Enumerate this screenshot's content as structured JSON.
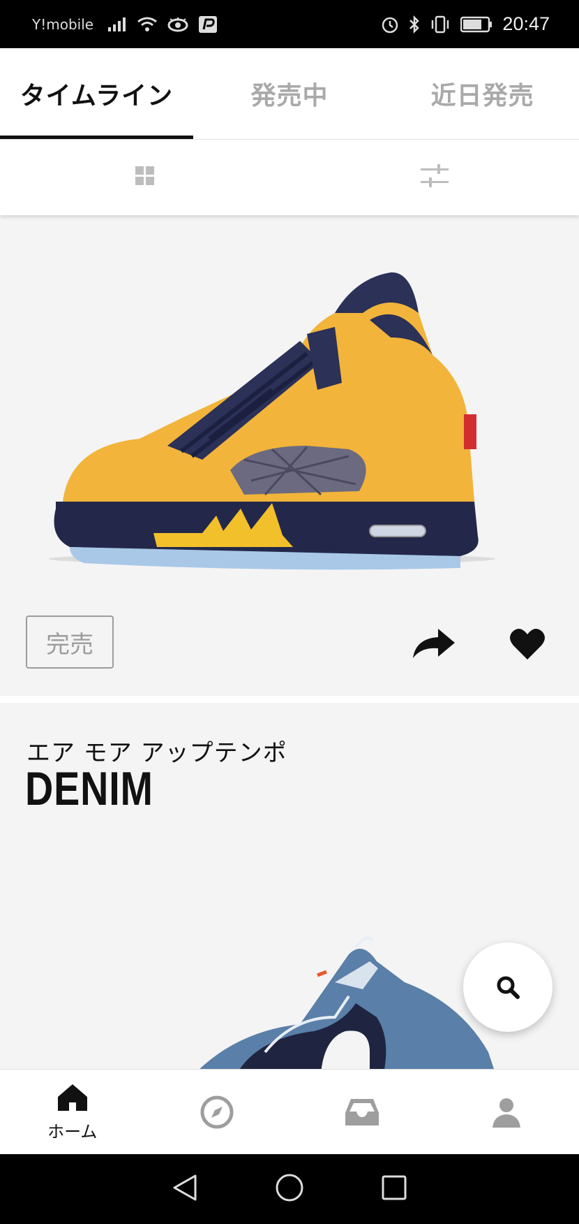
{
  "status_bar": {
    "carrier": "Y!mobile",
    "time": "20:47",
    "icons": [
      "signal-icon",
      "wifi-icon",
      "eye-icon",
      "paypay-icon",
      "alarm-icon",
      "bluetooth-icon",
      "vibrate-icon",
      "battery-icon"
    ]
  },
  "tabs": [
    {
      "label": "タイムライン",
      "active": true
    },
    {
      "label": "発売中",
      "active": false
    },
    {
      "label": "近日発売",
      "active": false
    }
  ],
  "toolbar": {
    "icons": [
      "grid-view-icon",
      "filter-sliders-icon"
    ]
  },
  "feed": {
    "card1": {
      "status_label": "完売",
      "actions": [
        "share-icon",
        "heart-icon"
      ]
    },
    "card2": {
      "subtitle": "エア モア アップテンポ",
      "title": "DENIM"
    }
  },
  "fab": {
    "icon": "search-icon"
  },
  "bottom_nav": [
    {
      "icon": "home-icon",
      "label": "ホーム",
      "active": true
    },
    {
      "icon": "compass-icon",
      "label": "",
      "active": false
    },
    {
      "icon": "inbox-icon",
      "label": "",
      "active": false
    },
    {
      "icon": "profile-icon",
      "label": "",
      "active": false
    }
  ],
  "colors": {
    "accent": "#111111",
    "inactive_tab": "#a9a9a9",
    "background": "#f4f4f4",
    "shoe_yellow": "#f2b43a",
    "shoe_navy": "#22274a"
  }
}
